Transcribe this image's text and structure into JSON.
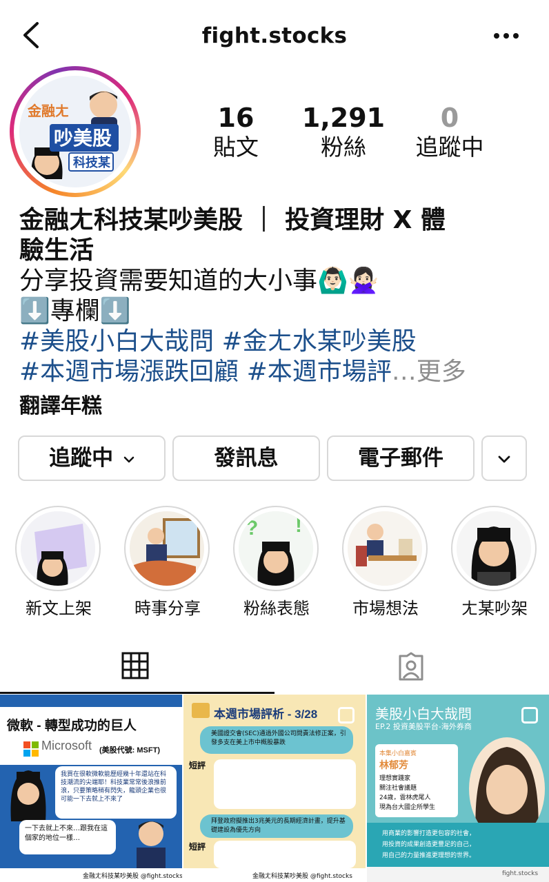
{
  "header": {
    "username": "fight.stocks"
  },
  "avatar": {
    "text_top": "金融ㄤ",
    "text_main": "吵美股",
    "text_bottom": "科技某"
  },
  "stats": [
    {
      "value": "16",
      "label": "貼文"
    },
    {
      "value": "1,291",
      "label": "粉絲"
    },
    {
      "value": "0",
      "label": "追蹤中"
    }
  ],
  "bio": {
    "name_line1": "金融ㄤ科技某吵美股 ｜ 投資理財 X 體",
    "name_line2": "驗生活",
    "line1": "分享投資需要知道的大小事🙆🏻‍♂️🙅🏻‍♀️",
    "line2": "⬇️專欄⬇️",
    "hashtags_line1": "#美股小白大哉問 #金ㄤ水某吵美股",
    "hashtags_line2": "#本週市場漲跌回顧 #本週市場評",
    "ellipsis": "…",
    "more": "更多",
    "subtitle": "翻譯年糕"
  },
  "buttons": {
    "following": "追蹤中",
    "message": "發訊息",
    "email": "電子郵件"
  },
  "highlights": [
    {
      "label": "新文上架"
    },
    {
      "label": "時事分享"
    },
    {
      "label": "粉絲表態"
    },
    {
      "label": "市場想法"
    },
    {
      "label": "ㄤ某吵架"
    }
  ],
  "posts": [
    {
      "title": "微軟 - 轉型成功的巨人",
      "brand": "Microsoft",
      "code": "(美股代號: MSFT)",
      "bubble1": "我買在很軟微軟能歷經幾十年還站在科技潮流的尖端耶！科技業常常後浪推前浪，只要策略稍有閃失，龍頭企業也很可能一下去就上不來了",
      "bubble2": "一下去就上不來…跟我在這個家的地位一樣…",
      "footer": "金融ㄤ科技某吵美股 @fight.stocks"
    },
    {
      "title": "本週市場評析 - 3/28",
      "item1": "美國證交會(SEC)通過外國公司問責法修正案，引發多支在美上市中概股暴跌",
      "label1": "短評",
      "item2": "拜登政府擬推出3兆美元的長期經濟計畫，提升基礎建設為優先方向",
      "label2": "短評",
      "footer": "金融ㄤ科技某吵美股 @fight.stocks"
    },
    {
      "title": "美股小白大哉問",
      "episode": "EP.2 投資美股平台-海外券商",
      "guest_label": "本集小白嘉賓",
      "guest_name": "林郁芳",
      "guest_info1": "理想實踐家",
      "guest_info2": "關注社會議題",
      "guest_info3": "24歲，雲林虎尾人",
      "guest_info4": "現為台大國企所學生",
      "quote1": "用商業的影響打造更包容的社會，",
      "quote2": "用投資的成果創造更豐足的自己，",
      "quote3": "用自己的力量推進更理想的世界。",
      "footer": "fight.stocks"
    }
  ],
  "colors": {
    "hashtag": "#1c4f8b",
    "border": "#d8d8d8",
    "muted": "#8e8e8e"
  },
  "icons": [
    "chevron-left-icon",
    "more-horizontal-icon",
    "chevron-down-icon",
    "grid-icon",
    "tagged-user-icon",
    "multiple-posts-icon"
  ]
}
